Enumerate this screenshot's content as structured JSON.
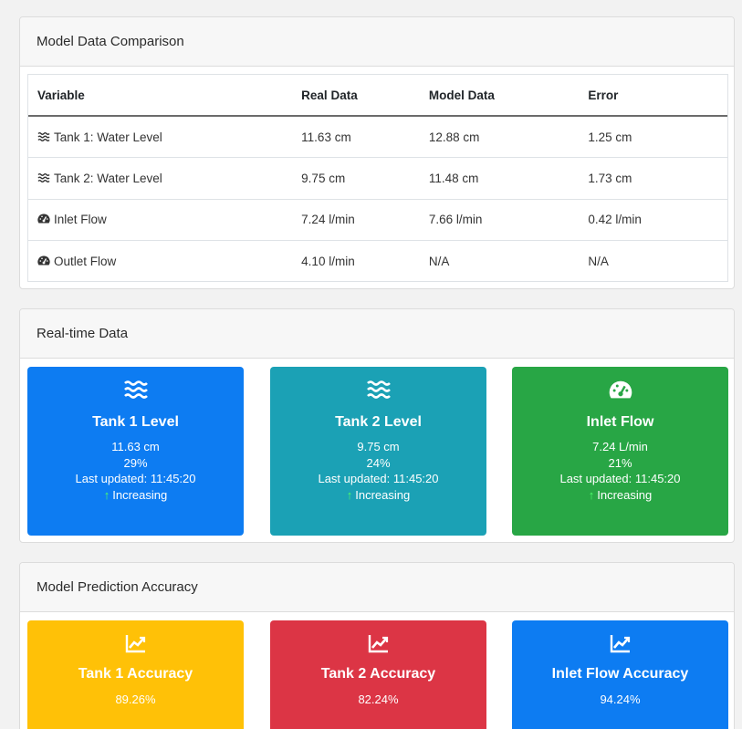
{
  "comparison": {
    "title": "Model Data Comparison",
    "headers": [
      "Variable",
      "Real Data",
      "Model Data",
      "Error"
    ],
    "rows": [
      {
        "icon": "water-icon",
        "variable": "Tank 1: Water Level",
        "real": "11.63 cm",
        "model": "12.88 cm",
        "error": "1.25 cm"
      },
      {
        "icon": "water-icon",
        "variable": "Tank 2: Water Level",
        "real": "9.75 cm",
        "model": "11.48 cm",
        "error": "1.73 cm"
      },
      {
        "icon": "gauge-icon",
        "variable": "Inlet Flow",
        "real": "7.24 l/min",
        "model": "7.66 l/min",
        "error": "0.42 l/min"
      },
      {
        "icon": "gauge-icon",
        "variable": "Outlet Flow",
        "real": "4.10 l/min",
        "model": "N/A",
        "error": "N/A"
      }
    ]
  },
  "realtime": {
    "title": "Real-time Data",
    "tiles": [
      {
        "icon": "water-icon",
        "title": "Tank 1 Level",
        "value": "11.63 cm",
        "percent": "29%",
        "updated": "Last updated: 11:45:20",
        "trend": "Increasing",
        "color": "#0d7cf2"
      },
      {
        "icon": "water-icon",
        "title": "Tank 2 Level",
        "value": "9.75 cm",
        "percent": "24%",
        "updated": "Last updated: 11:45:20",
        "trend": "Increasing",
        "color": "#1ba1b5"
      },
      {
        "icon": "gauge-icon",
        "title": "Inlet Flow",
        "value": "7.24 L/min",
        "percent": "21%",
        "updated": "Last updated: 11:45:20",
        "trend": "Increasing",
        "color": "#28a645"
      }
    ],
    "trend_arrow": "↑"
  },
  "accuracy": {
    "title": "Model Prediction Accuracy",
    "tiles": [
      {
        "icon": "chart-area-icon",
        "title": "Tank 1 Accuracy",
        "value": "89.26%",
        "color": "#ffc107"
      },
      {
        "icon": "chart-area-icon",
        "title": "Tank 2 Accuracy",
        "value": "82.24%",
        "color": "#dc3545"
      },
      {
        "icon": "chart-area-icon",
        "title": "Inlet Flow Accuracy",
        "value": "94.24%",
        "color": "#0d7cf2"
      }
    ]
  }
}
